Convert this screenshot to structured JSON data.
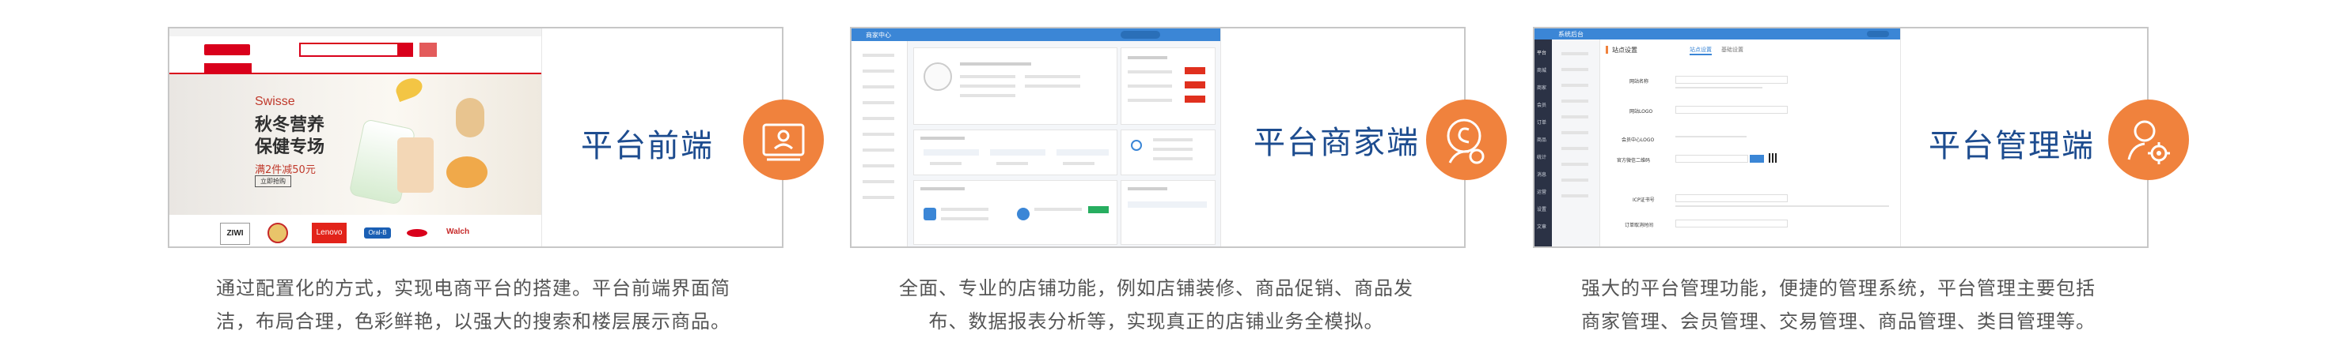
{
  "panels": [
    {
      "title": "平台前端",
      "icon": "user-id-card-icon",
      "description_line1": "通过配置化的方式，实现电商平台的搭建。平台前端界面简",
      "description_line2": "洁，布局合理，色彩鲜艳，以强大的搜索和楼层展示商品。",
      "banner_brand": "Swisse",
      "banner_title_1": "秋冬营养",
      "banner_title_2": "保健专场",
      "banner_promo": "满2件减50元",
      "banner_button": "立即抢购",
      "brands": [
        "ZIWI",
        "Lenovo",
        "Oral-B",
        "Walch"
      ]
    },
    {
      "title": "平台商家端",
      "icon": "shop-user-icon",
      "description_line1": "全面、专业的店铺功能，例如店铺装修、商品促销、商品发",
      "description_line2": "布、数据报表分析等，实现真正的店铺业务全模拟。",
      "app_name": "商家中心"
    },
    {
      "title": "平台管理端",
      "icon": "user-settings-icon",
      "description_line1": "强大的平台管理功能，便捷的管理系统，平台管理主要包括",
      "description_line2": "商家管理、会员管理、交易管理、商品管理、类目管理等。",
      "app_name": "系统后台",
      "page_heading": "站点设置",
      "tabs": [
        "站点设置",
        "基础设置"
      ],
      "sidebar": [
        "平台",
        "商城",
        "商家",
        "会员",
        "订单",
        "商品",
        "统计",
        "消息",
        "运营",
        "设置",
        "文章"
      ],
      "form_labels": [
        "网站名称",
        "网站LOGO",
        "会员中心LOGO",
        "官方微信二维码",
        "ICP证书号",
        "订单取消时间"
      ]
    }
  ],
  "colors": {
    "accent_orange": "#f0823d",
    "title_blue": "#1d4c8f",
    "merchant_blue": "#3b86d6",
    "admin_dark": "#2b3245",
    "frontend_red": "#d9001b"
  }
}
